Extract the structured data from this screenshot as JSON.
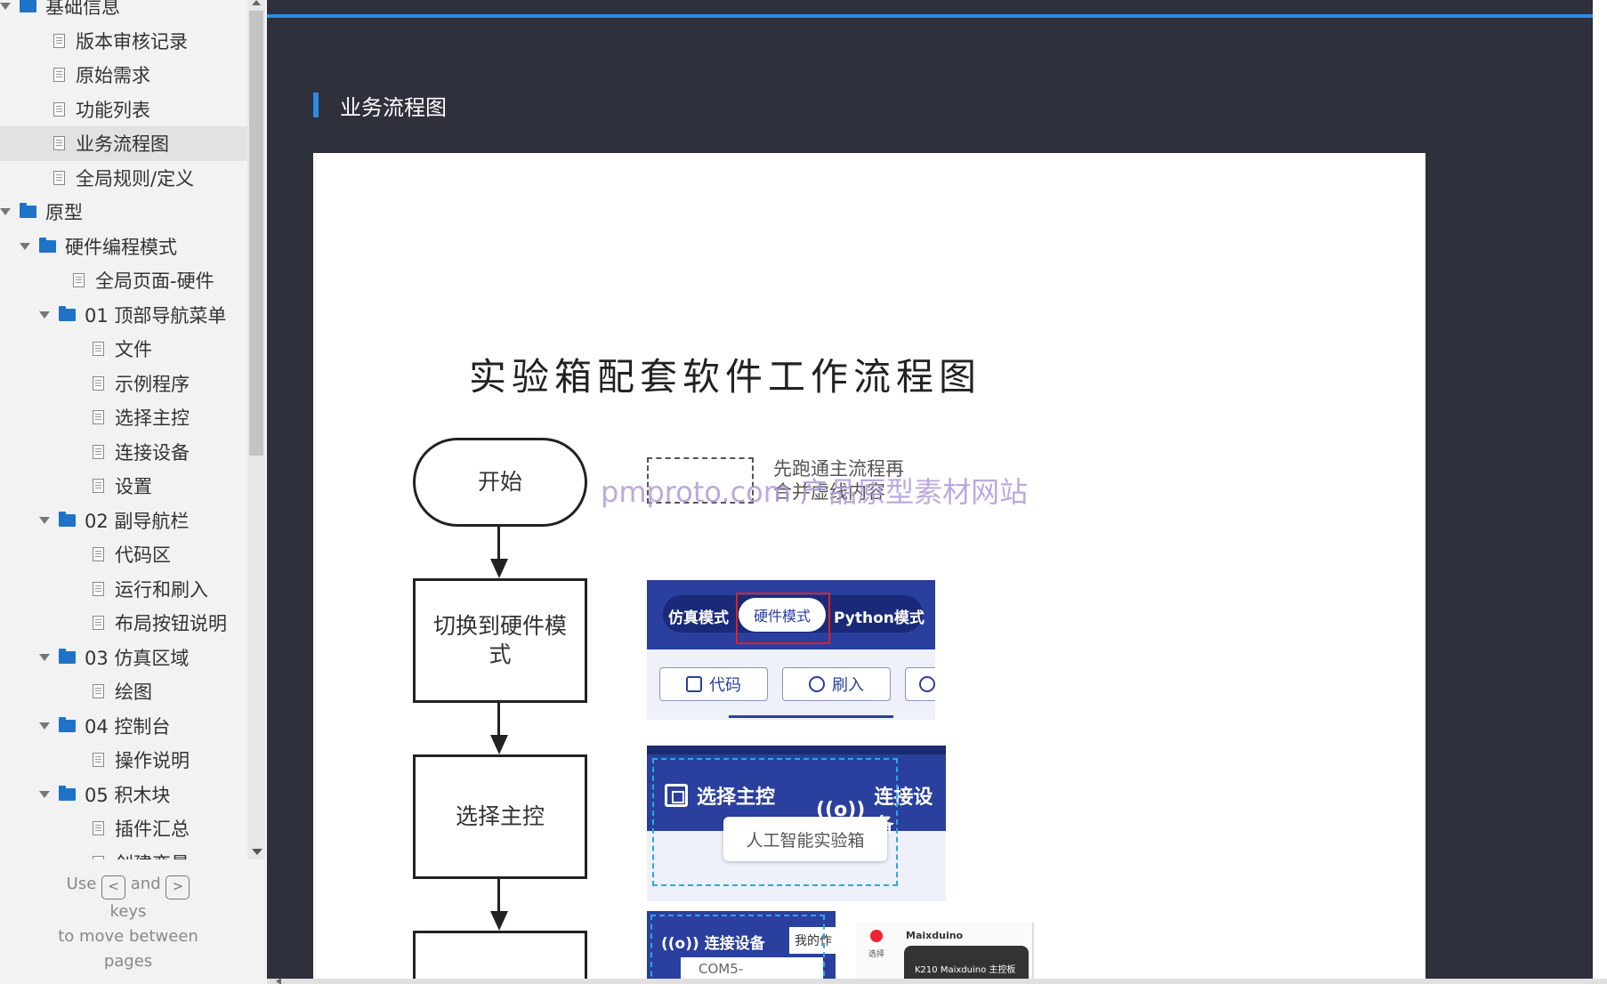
{
  "sidebar": {
    "items": [
      {
        "label": "基础信息",
        "type": "folder",
        "level": 0,
        "expanded": true
      },
      {
        "label": "版本审核记录",
        "type": "page",
        "level": 1
      },
      {
        "label": "原始需求",
        "type": "page",
        "level": 1
      },
      {
        "label": "功能列表",
        "type": "page",
        "level": 1
      },
      {
        "label": "业务流程图",
        "type": "page",
        "level": 1,
        "selected": true
      },
      {
        "label": "全局规则/定义",
        "type": "page",
        "level": 1
      },
      {
        "label": "原型",
        "type": "folder",
        "level": 0,
        "expanded": true
      },
      {
        "label": "硬件编程模式",
        "type": "folder",
        "level": 1,
        "expanded": true
      },
      {
        "label": "全局页面-硬件",
        "type": "page",
        "level": 2
      },
      {
        "label": "01 顶部导航菜单",
        "type": "folder",
        "level": 2,
        "expanded": true
      },
      {
        "label": "文件",
        "type": "page",
        "level": 3
      },
      {
        "label": "示例程序",
        "type": "page",
        "level": 3
      },
      {
        "label": "选择主控",
        "type": "page",
        "level": 3
      },
      {
        "label": "连接设备",
        "type": "page",
        "level": 3
      },
      {
        "label": "设置",
        "type": "page",
        "level": 3
      },
      {
        "label": "02 副导航栏",
        "type": "folder",
        "level": 2,
        "expanded": true
      },
      {
        "label": "代码区",
        "type": "page",
        "level": 3
      },
      {
        "label": "运行和刷入",
        "type": "page",
        "level": 3
      },
      {
        "label": "布局按钮说明",
        "type": "page",
        "level": 3
      },
      {
        "label": "03 仿真区域",
        "type": "folder",
        "level": 2,
        "expanded": true
      },
      {
        "label": "绘图",
        "type": "page",
        "level": 3
      },
      {
        "label": "04 控制台",
        "type": "folder",
        "level": 2,
        "expanded": true
      },
      {
        "label": "操作说明",
        "type": "page",
        "level": 3
      },
      {
        "label": "05 积木块",
        "type": "folder",
        "level": 2,
        "expanded": true
      },
      {
        "label": "插件汇总",
        "type": "page",
        "level": 3
      },
      {
        "label": "创建变量",
        "type": "page",
        "level": 3
      }
    ],
    "help": {
      "use": "Use",
      "prev_key": "<",
      "and": "and",
      "next_key": ">",
      "keys": "keys",
      "rest": "to move between",
      "pages": "pages"
    }
  },
  "main": {
    "section_title": "业务流程图",
    "flowchart": {
      "title": "实验箱配套软件工作流程图",
      "nodes": {
        "start": "开始",
        "switch_mode": "切换到硬件模式",
        "select_controller": "选择主控"
      },
      "legend": {
        "line1": "先跑通主流程再",
        "line2": "合并虚线内容"
      },
      "watermark": "pmproto.com 产品原型素材网站",
      "screenshot_mode": {
        "sim_mode": "仿真模式",
        "hw_mode": "硬件模式",
        "py_mode": "Python模式",
        "code_btn": "代码",
        "flash_btn": "刷入"
      },
      "screenshot_select": {
        "select_controller": "选择主控",
        "connect_device": "连接设备",
        "dropdown_value": "人工智能实验箱"
      },
      "screenshot_connect": {
        "connect_device": "连接设备",
        "tab": "我的作",
        "com": "COM5-"
      },
      "screenshot_board": {
        "name": "Maixduino",
        "small": "选择",
        "board": "K210 Maixduino 主控板"
      }
    }
  },
  "colors": {
    "accent": "#2d8ce6",
    "main_bg": "#2e303b",
    "sidebar_bg": "#f2f2f2",
    "folder": "#1e73c8",
    "ui_blue": "#2a3f9e"
  }
}
